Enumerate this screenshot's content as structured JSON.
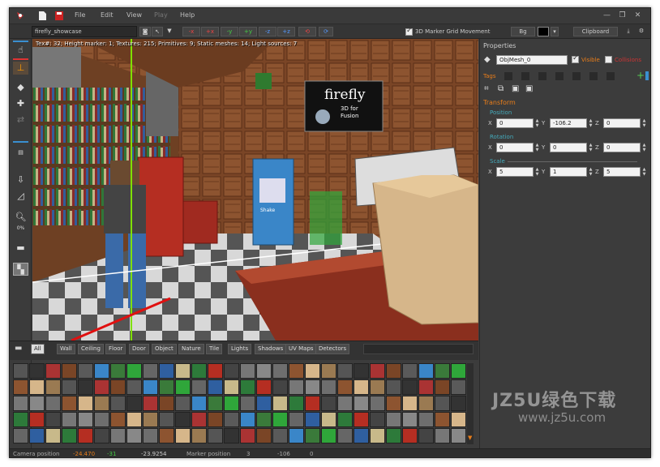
{
  "menu": [
    "File",
    "Edit",
    "View",
    "Play",
    "Help"
  ],
  "toolbar": {
    "scene_name": "firefly_showcase",
    "grid_movement_label": "3D Marker Grid Movement",
    "grid_movement_checked": true,
    "bg_label": "Bg",
    "clipboard_label": "Clipboard",
    "axis_buttons": [
      "-x",
      "+x",
      "-y",
      "+y",
      "-z",
      "+z"
    ]
  },
  "viewport": {
    "info": "Tex#: 32; Height marker: 1; Textures: 215; Primitives: 9; Static meshes: 14; Light sources: 7",
    "sign_title": "firefly",
    "sign_sub1": "3D for",
    "sign_sub2": "Fusion",
    "vending_label": "Shake"
  },
  "properties": {
    "title": "Properties",
    "object_name": "ObjMesh_0",
    "visible_label": "Visible",
    "visible_checked": true,
    "collisions_label": "Collisions",
    "collisions_checked": false,
    "tags_label": "Tags",
    "transform_label": "Transform",
    "position_label": "Position",
    "rotation_label": "Rotation",
    "scale_label": "Scale",
    "position": {
      "x": "0",
      "y": "-106.2",
      "z": "0"
    },
    "rotation": {
      "x": "0",
      "y": "0",
      "z": "0"
    },
    "scale": {
      "x": "5",
      "y": "1",
      "z": "5"
    }
  },
  "filters": [
    "All",
    "Wall",
    "Ceiling",
    "Floor",
    "Door",
    "Object",
    "Nature",
    "Tile",
    "Lights",
    "Shadows",
    "UV Maps",
    "Detectors"
  ],
  "active_filter": "All",
  "status": {
    "camera_label": "Camera position",
    "camera_x": "-24.470",
    "camera_y": "-31",
    "camera_z": "-23.9254",
    "marker_label": "Marker position",
    "marker_x": "3",
    "marker_y": "-106",
    "marker_z": "0"
  },
  "watermark": {
    "line1": "JZ5U绿色下载",
    "line2": "www.jz5u.com"
  },
  "colors": {
    "accent": "#e87d1a",
    "panel": "#3c3c3c"
  }
}
